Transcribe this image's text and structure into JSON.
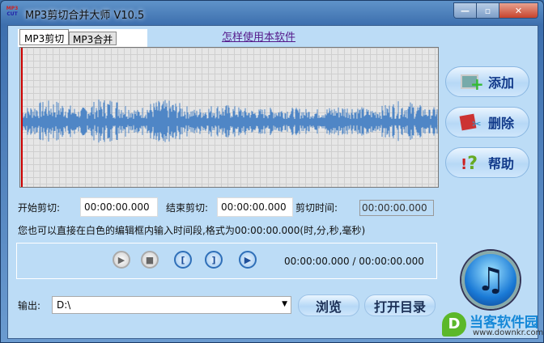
{
  "window": {
    "title": "MP3剪切合并大师 V10.5",
    "logo_top": "MP3",
    "logo_bottom": "CUT",
    "minimize": "—",
    "maximize": "▫",
    "close": "✕"
  },
  "tabs": [
    {
      "label": "MP3剪切",
      "active": true
    },
    {
      "label": "MP3合并",
      "active": false
    }
  ],
  "help_link": "怎样使用本软件",
  "side_buttons": {
    "add": "添加",
    "delete": "删除",
    "help": "帮助"
  },
  "times": {
    "start_label": "开始剪切:",
    "start_value": "00:00:00.000",
    "end_label": "结束剪切:",
    "end_value": "00:00:00.000",
    "duration_label": "剪切时间:",
    "duration_value": "00:00:00.000"
  },
  "hint": "您也可以直接在白色的编辑框内输入时间段,格式为00:00:00.000(时,分,秒,毫秒)",
  "player": {
    "play": "▶",
    "stop": "■",
    "mark_start": "[",
    "mark_end": "]",
    "play_selection": "▶",
    "position": "00:00:00.000 / 00:00:00.000"
  },
  "output": {
    "label": "输出:",
    "value": "D:\\",
    "browse": "浏览",
    "open_dir": "打开目录"
  },
  "watermark": {
    "name": "当客软件园",
    "url": "www.downkr.com"
  },
  "colors": {
    "waveform": "#4f86c6",
    "marker": "#cc0000",
    "client_bg": "#bcdcf6"
  }
}
